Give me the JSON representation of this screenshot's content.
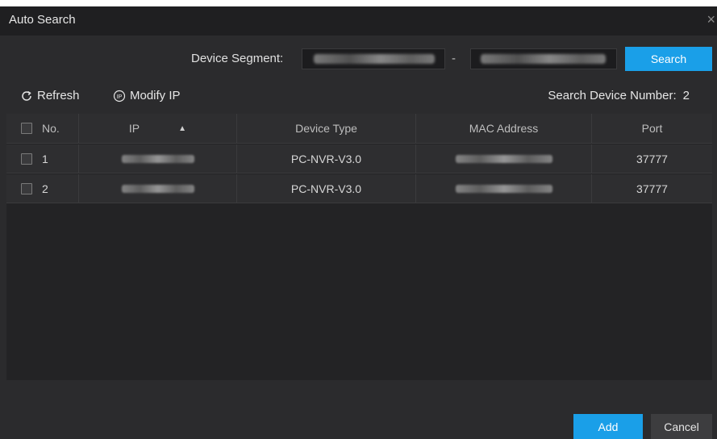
{
  "dialog": {
    "title": "Auto Search",
    "close_glyph": "×"
  },
  "segment": {
    "label": "Device Segment:",
    "separator": "-",
    "search_button": "Search"
  },
  "toolbar": {
    "refresh_label": "Refresh",
    "modify_ip_label": "Modify IP",
    "device_count_label": "Search Device Number:",
    "device_count": "2"
  },
  "table": {
    "headers": {
      "no": "No.",
      "ip": "IP",
      "device_type": "Device Type",
      "mac": "MAC Address",
      "port": "Port"
    },
    "rows": [
      {
        "no": "1",
        "device_type": "PC-NVR-V3.0",
        "port": "37777"
      },
      {
        "no": "2",
        "device_type": "PC-NVR-V3.0",
        "port": "37777"
      }
    ]
  },
  "footer": {
    "add_button": "Add",
    "cancel_button": "Cancel"
  },
  "colors": {
    "accent": "#1a9fe8",
    "background": "#2b2b2d",
    "titlebar": "#1f1f21"
  }
}
